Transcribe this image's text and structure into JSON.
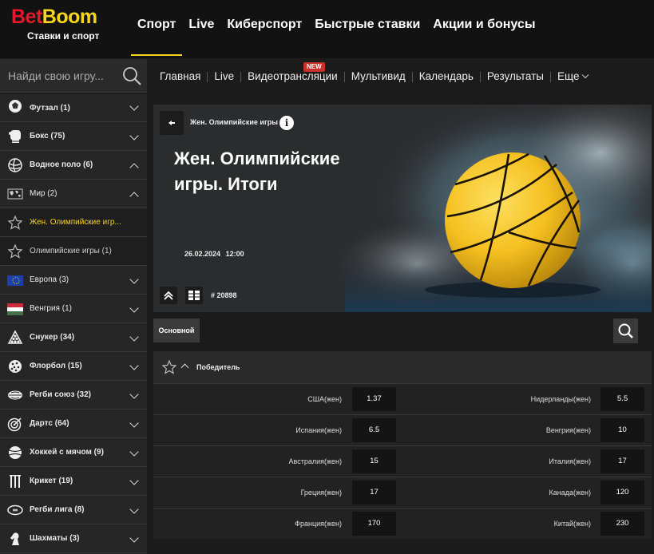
{
  "header": {
    "logo_part1": "Bet",
    "logo_part2": "Boom",
    "logo_sub": "Ставки и спорт",
    "nav": [
      "Спорт",
      "Live",
      "Киберспорт",
      "Быстрые ставки",
      "Акции и бонусы"
    ],
    "active_nav": 0
  },
  "search": {
    "placeholder": "Найди свою игру..."
  },
  "subnav": {
    "items": [
      "Главная",
      "Live",
      "Видеотрансляции",
      "Мультивид",
      "Календарь",
      "Результаты",
      "Еще"
    ],
    "new_badge": "NEW"
  },
  "sidebar": {
    "items": [
      {
        "label": "Футзал (1)",
        "icon": "futsal-icon",
        "state": "collapsed"
      },
      {
        "label": "Бокс (75)",
        "icon": "boxing-glove-icon",
        "state": "collapsed"
      },
      {
        "label": "Водное поло (6)",
        "icon": "water-polo-icon",
        "state": "expanded"
      },
      {
        "label": "Мир (2)",
        "icon": "world-map-icon",
        "state": "expanded"
      },
      {
        "label": "Жен. Олимпийские игр...",
        "icon": "star-icon",
        "state": "active"
      },
      {
        "label": "Олимпийские игры (1)",
        "icon": "star-icon",
        "state": "sub"
      },
      {
        "label": "Европа (3)",
        "icon": "eu-flag-icon",
        "state": "collapsed"
      },
      {
        "label": "Венгрия (1)",
        "icon": "hungary-flag-icon",
        "state": "collapsed"
      },
      {
        "label": "Снукер (34)",
        "icon": "snooker-icon",
        "state": "collapsed"
      },
      {
        "label": "Флорбол (15)",
        "icon": "floorball-icon",
        "state": "collapsed"
      },
      {
        "label": "Регби союз (32)",
        "icon": "rugby-ball-icon",
        "state": "collapsed"
      },
      {
        "label": "Дартс (64)",
        "icon": "darts-icon",
        "state": "collapsed"
      },
      {
        "label": "Хоккей с мячом (9)",
        "icon": "bandy-ball-icon",
        "state": "collapsed"
      },
      {
        "label": "Крикет (19)",
        "icon": "cricket-icon",
        "state": "collapsed"
      },
      {
        "label": "Регби лига (8)",
        "icon": "rugby-ball-icon",
        "state": "collapsed"
      },
      {
        "label": "Шахматы (3)",
        "icon": "chess-knight-icon",
        "state": "collapsed"
      }
    ]
  },
  "banner": {
    "crumb": "Жен. Олимпийские игры",
    "title": "Жен. Олимпийские игры. Итоги",
    "date": "26.02.2024",
    "time": "12:00",
    "match_id": "# 20898"
  },
  "tabs": {
    "main": "Основной"
  },
  "market": {
    "title": "Победитель",
    "rows": [
      {
        "left_name": "США(жен)",
        "left_odd": "1.37",
        "right_name": "Нидерланды(жен)",
        "right_odd": "5.5"
      },
      {
        "left_name": "Испания(жен)",
        "left_odd": "6.5",
        "right_name": "Венгрия(жен)",
        "right_odd": "10"
      },
      {
        "left_name": "Австралия(жен)",
        "left_odd": "15",
        "right_name": "Италия(жен)",
        "right_odd": "17"
      },
      {
        "left_name": "Греция(жен)",
        "left_odd": "17",
        "right_name": "Канада(жен)",
        "right_odd": "120"
      },
      {
        "left_name": "Франция(жен)",
        "left_odd": "170",
        "right_name": "Китай(жен)",
        "right_odd": "230"
      }
    ]
  },
  "colors": {
    "accent": "#f7d51d",
    "brand_red": "#e8182c",
    "ball": "#f5c020"
  }
}
